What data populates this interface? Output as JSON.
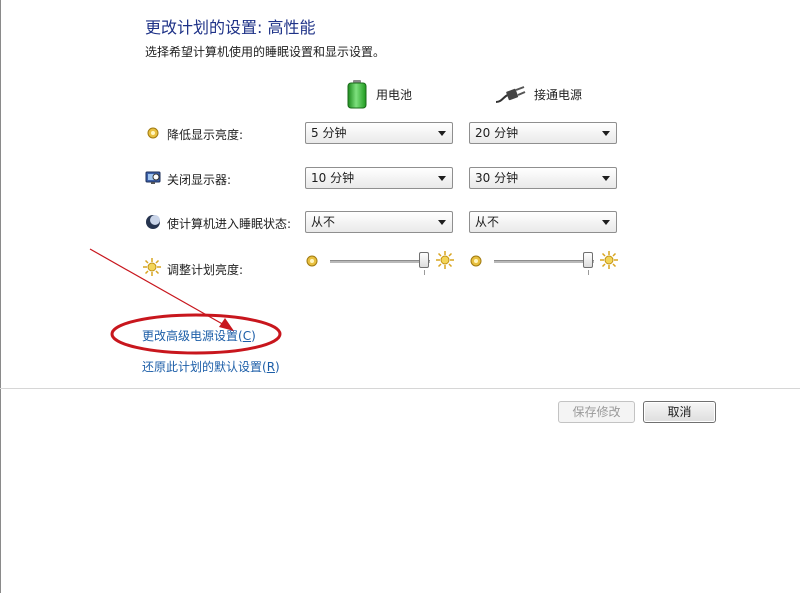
{
  "page": {
    "title": "更改计划的设置: 高性能",
    "subtitle": "选择希望计算机使用的睡眠设置和显示设置。"
  },
  "columns": {
    "battery": {
      "label": "用电池",
      "icon": "battery-icon"
    },
    "plugged": {
      "label": "接通电源",
      "icon": "power-plug-icon"
    }
  },
  "settings": {
    "dim_display": {
      "label": "降低显示亮度:",
      "icon": "dim-display-icon",
      "battery_value": "5 分钟",
      "plugged_value": "20 分钟"
    },
    "turn_off_display": {
      "label": "关闭显示器:",
      "icon": "monitor-icon",
      "battery_value": "10 分钟",
      "plugged_value": "30 分钟"
    },
    "sleep": {
      "label": "使计算机进入睡眠状态:",
      "icon": "sleep-moon-icon",
      "battery_value": "从不",
      "plugged_value": "从不"
    },
    "brightness": {
      "label": "调整计划亮度:",
      "icon": "brightness-sun-icon",
      "battery_level": 1.0,
      "plugged_level": 1.0
    }
  },
  "links": {
    "advanced_label": "更改高级电源设置(",
    "advanced_key": "C",
    "restore_label": "还原此计划的默认设置(",
    "restore_key": "R"
  },
  "buttons": {
    "save": "保存修改",
    "cancel": "取消"
  },
  "colors": {
    "title": "#1e3287",
    "link": "#1c5ea8",
    "annotation": "#c8161d",
    "battery_green": "#3fbf3f"
  }
}
